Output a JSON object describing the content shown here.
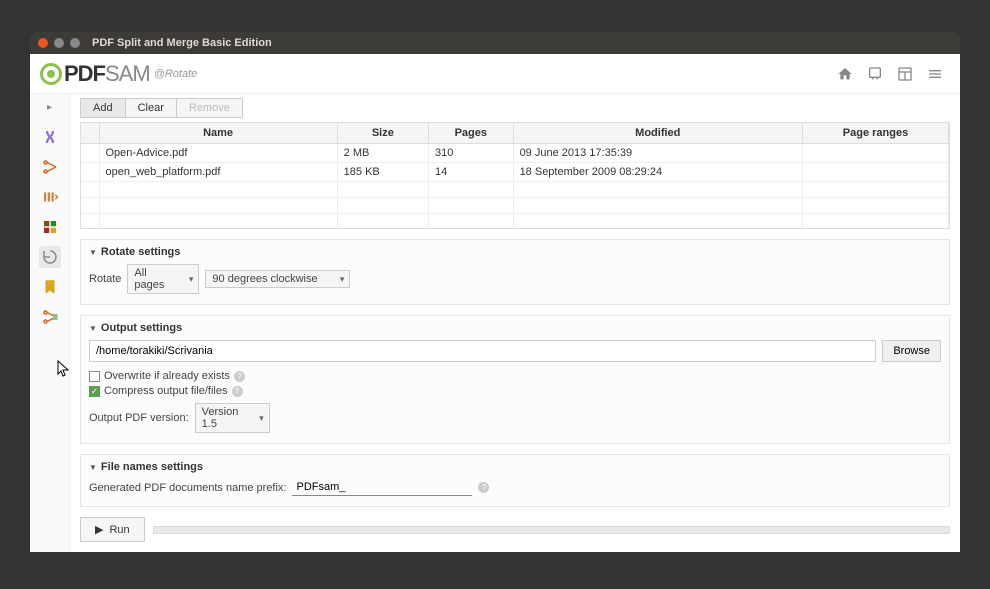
{
  "window_title": "PDF Split and Merge Basic Edition",
  "logo": {
    "pdf": "PDF",
    "sam": "SAM"
  },
  "breadcrumb": "@Rotate",
  "toolbar": {
    "add": "Add",
    "clear": "Clear",
    "remove": "Remove"
  },
  "table": {
    "columns": [
      "",
      "Name",
      "Size",
      "Pages",
      "Modified",
      "Page ranges"
    ],
    "rows": [
      {
        "name": "Open-Advice.pdf",
        "size": "2 MB",
        "pages": "310",
        "modified": "09 June 2013 17:35:39",
        "ranges": ""
      },
      {
        "name": "open_web_platform.pdf",
        "size": "185 KB",
        "pages": "14",
        "modified": "18 September 2009 08:29:24",
        "ranges": ""
      }
    ]
  },
  "rotate_settings": {
    "title": "Rotate settings",
    "label": "Rotate",
    "pages_option": "All pages",
    "degrees_option": "90 degrees clockwise"
  },
  "output_settings": {
    "title": "Output settings",
    "path": "/home/torakiki/Scrivania",
    "browse": "Browse",
    "overwrite": "Overwrite if already exists",
    "compress": "Compress output file/files",
    "version_label": "Output PDF version:",
    "version_value": "Version 1.5"
  },
  "filename_settings": {
    "title": "File names settings",
    "prefix_label": "Generated PDF documents name prefix:",
    "prefix_value": "PDFsam_"
  },
  "run": "Run"
}
